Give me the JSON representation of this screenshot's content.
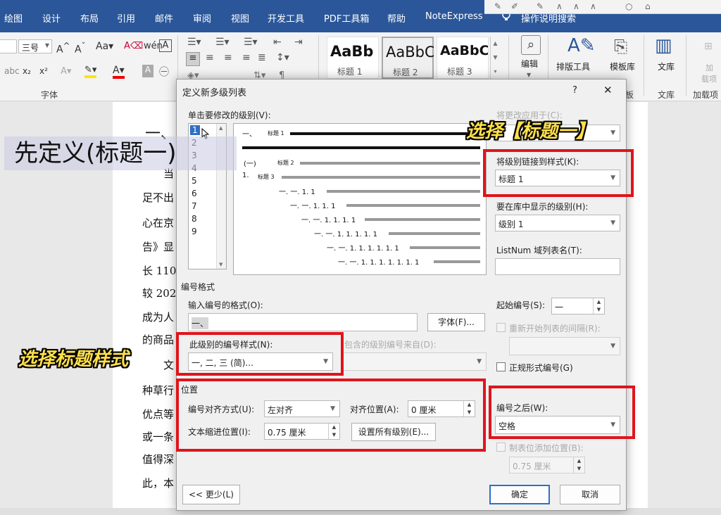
{
  "ribbon": {
    "tabs": [
      "绘图",
      "设计",
      "布局",
      "引用",
      "邮件",
      "审阅",
      "视图",
      "开发工具",
      "PDF工具箱",
      "帮助",
      "NoteExpress"
    ],
    "search_label": "操作说明搜索",
    "font_size": "三号",
    "font_group_label": "字体",
    "styles": [
      {
        "sample": "AaBb",
        "name": "标题 1"
      },
      {
        "sample": "AaBbC",
        "name": "标题 2"
      },
      {
        "sample": "AaBbC",
        "name": "标题 3"
      }
    ],
    "edit_label": "编辑",
    "layout_tool_label": "排版工具",
    "template_lib_label": "模板库",
    "doc_label": "文库",
    "doc_group_label": "文库",
    "addin_label": "加载项",
    "addin_group_label": "加载项",
    "addin_disabled_top": "加",
    "addin_disabled_bottom": "载项",
    "misc_label": "板"
  },
  "document": {
    "heading_frag": "一、",
    "lines": [
      "当",
      "足不出",
      "心在京",
      "告》显",
      "长 110",
      "较 202",
      "成为人",
      "的商品",
      "文",
      "种草行",
      "优点等",
      "或一条",
      "值得深",
      "此，本"
    ]
  },
  "overlay": {
    "define_text": "先定义(标题一)",
    "callout_select_heading1": "选择【标题一】",
    "callout_select_style": "选择标题样式"
  },
  "dialog": {
    "title": "定义新多级列表",
    "help_label": "?",
    "close_label": "✕",
    "level_select_label": "单击要修改的级别(V):",
    "levels": [
      "1",
      "2",
      "3",
      "4",
      "5",
      "6",
      "7",
      "8",
      "9"
    ],
    "selected_level": "1",
    "apply_to_label": "将更改应用于(C):",
    "apply_to_value": "",
    "link_style_label": "将级别链接到样式(K):",
    "link_style_value": "标题 1",
    "gallery_level_label": "要在库中显示的级别(H):",
    "gallery_level_value": "级别 1",
    "listnum_label": "ListNum 域列表名(T):",
    "listnum_value": "",
    "preview": [
      {
        "num": "一、",
        "label": "标题 1"
      },
      {
        "num": "(一)",
        "label": "标题 2"
      },
      {
        "num": "1.",
        "label": "标题 3"
      },
      {
        "num": "一. 一. 1. 1",
        "label": ""
      },
      {
        "num": "一. 一. 1. 1. 1",
        "label": ""
      },
      {
        "num": "一. 一. 1. 1. 1. 1",
        "label": ""
      },
      {
        "num": "一. 一. 1. 1. 1. 1. 1",
        "label": ""
      },
      {
        "num": "一. 一. 1. 1. 1. 1. 1. 1",
        "label": ""
      },
      {
        "num": "一. 一. 1. 1. 1. 1. 1. 1. 1",
        "label": ""
      }
    ],
    "number_format_section": "编号格式",
    "enter_format_label": "输入编号的格式(O):",
    "enter_format_value": "一、",
    "font_button": "字体(F)...",
    "start_at_label": "起始编号(S):",
    "start_at_value": "一",
    "restart_label": "重新开始列表的间隔(R):",
    "restart_value": "",
    "number_style_label": "此级别的编号样式(N):",
    "number_style_value": "一, 二, 三 (简)...",
    "include_level_label": "包含的级别编号来自(D):",
    "include_level_value": "",
    "legal_label": "正规形式编号(G)",
    "position_section": "位置",
    "alignment_label": "编号对齐方式(U):",
    "alignment_value": "左对齐",
    "aligned_at_label": "对齐位置(A):",
    "aligned_at_value": "0 厘米",
    "indent_label": "文本缩进位置(I):",
    "indent_value": "0.75 厘米",
    "set_all_button": "设置所有级别(E)...",
    "follow_label": "编号之后(W):",
    "follow_value": "空格",
    "tab_stop_label": "制表位添加位置(B):",
    "tab_stop_value": "0.75 厘米",
    "less_button": "<< 更少(L)",
    "ok_button": "确定",
    "cancel_button": "取消"
  },
  "colors": {
    "ribbon_blue": "#2b579a",
    "callout_yellow": "#ffe04a",
    "highlight_red": "#e0141c",
    "selection_blue": "#2f6ec7"
  }
}
